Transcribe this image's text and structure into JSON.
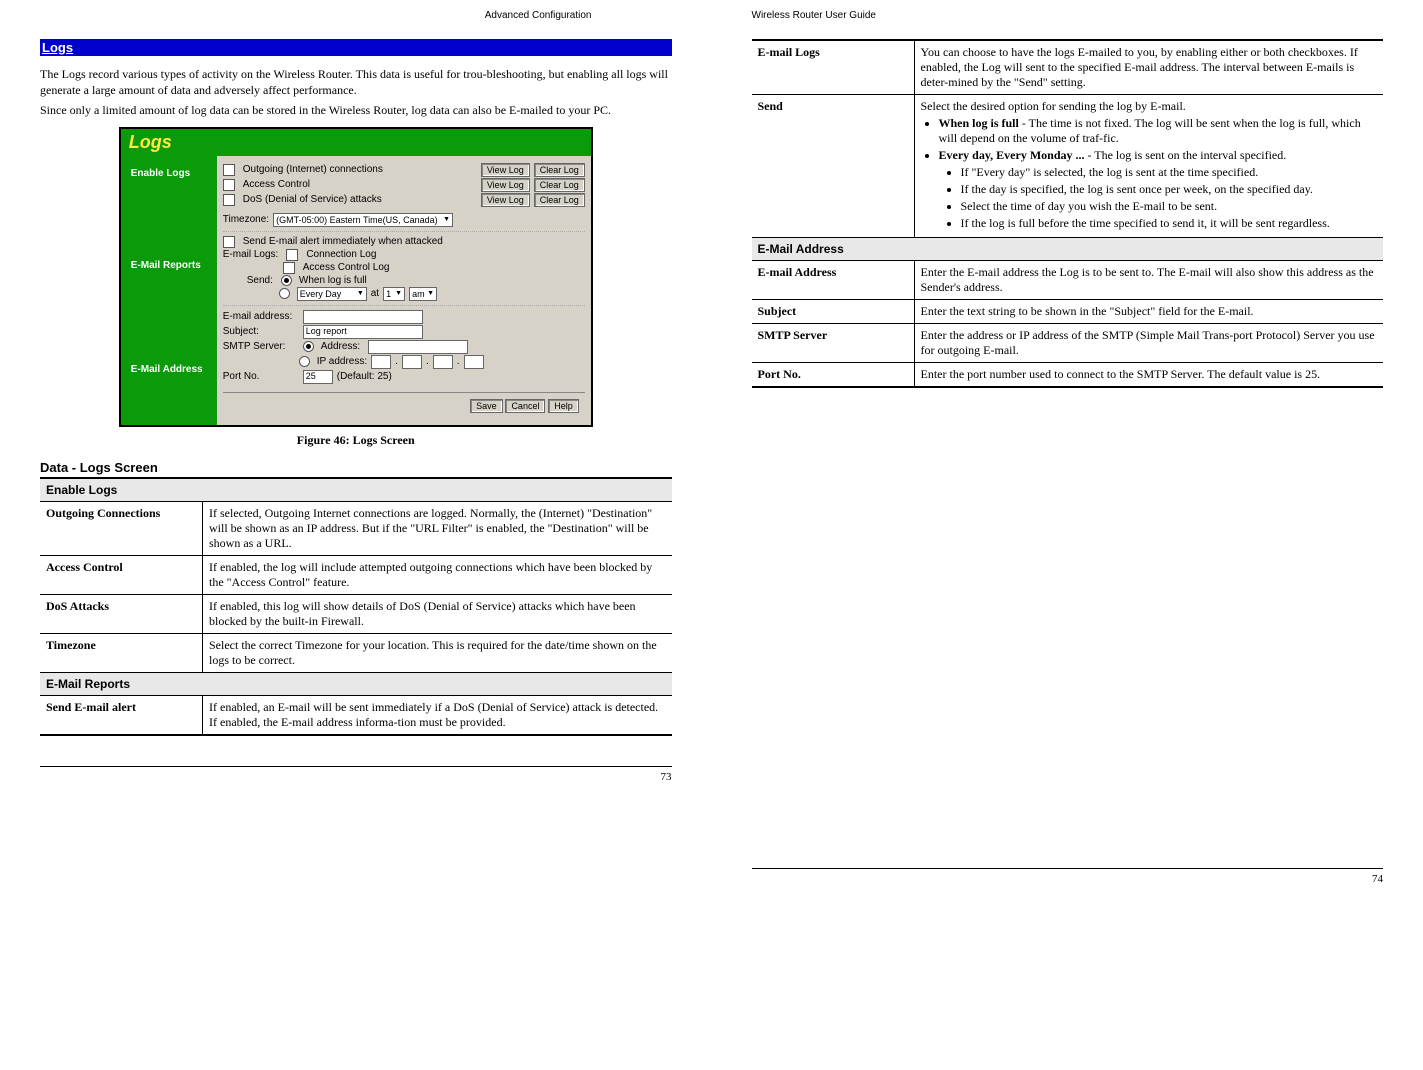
{
  "leftHeader": "Advanced Configuration",
  "rightHeader": "Wireless Router User Guide",
  "leftPageNum": "73",
  "rightPageNum": "74",
  "logs": {
    "bar": "Logs",
    "intro1": "The Logs record various types of activity on the Wireless Router. This data is useful for trou-bleshooting, but enabling all logs will generate a large amount of data and adversely affect performance.",
    "intro2": "Since only a limited amount of log data can be stored in the Wireless Router, log data can also be E-mailed to your PC.",
    "figCaption": "Figure 46: Logs Screen",
    "dataHeader": "Data - Logs Screen",
    "window": {
      "title": "Logs",
      "tab1": "Enable Logs",
      "tab2": "E-Mail Reports",
      "tab3": "E-Mail Address",
      "cb1": "Outgoing (Internet) connections",
      "cb2": "Access Control",
      "cb3": "DoS (Denial of Service) attacks",
      "viewLog": "View Log",
      "clearLog": "Clear Log",
      "tzLabel": "Timezone:",
      "tzValue": "(GMT-05:00) Eastern Time(US, Canada)",
      "alertCb": "Send E-mail alert immediately when attacked",
      "emailLogsLbl": "E-mail Logs:",
      "connLog": "Connection Log",
      "accLog": "Access Control Log",
      "sendLbl": "Send:",
      "sendOpt1": "When log is full",
      "sendOpt2": "Every Day",
      "atLbl": "at",
      "hourVal": "1",
      "ampmVal": "am",
      "emailAddrLbl": "E-mail address:",
      "subjectLbl": "Subject:",
      "subjectVal": "Log report",
      "smtpLbl": "SMTP Server:",
      "smtpAddr": "Address:",
      "smtpIp": "IP address:",
      "portLbl": "Port No.",
      "portVal": "25",
      "portDefault": "(Default: 25)",
      "save": "Save",
      "cancel": "Cancel",
      "help": "Help"
    },
    "tableLeft": {
      "sec1": "Enable Logs",
      "r1k": "Outgoing Connections",
      "r1v": "If selected, Outgoing Internet connections are logged. Normally, the (Internet) \"Destination\" will be shown as an IP address. But if the \"URL Filter\" is enabled, the \"Destination\" will be shown as a URL.",
      "r2k": "Access Control",
      "r2v": "If enabled, the log will include attempted outgoing connections which have been blocked by the \"Access Control\" feature.",
      "r3k": "DoS Attacks",
      "r3v": "If enabled, this log will show details of DoS (Denial of Service) attacks which have been blocked by the built-in Firewall.",
      "r4k": "Timezone",
      "r4v": "Select the correct Timezone for your location. This is required for the date/time shown on the logs to be correct.",
      "sec2": "E-Mail Reports",
      "r5k": "Send E-mail alert",
      "r5v": "If enabled, an E-mail will be sent immediately if a DoS (Denial of Service) attack is detected. If enabled, the E-mail address informa-tion must be provided."
    },
    "tableRight": {
      "r1k": "E-mail Logs",
      "r1v": "You can choose to have the logs E-mailed to you, by enabling either or both checkboxes. If enabled, the Log will sent to the specified E-mail address. The interval between E-mails is deter-mined by the \"Send\" setting.",
      "r2k": "Send",
      "r2v_intro": "Select the desired option for sending the log by E-mail.",
      "r2_b1_strong": "When log is full",
      "r2_b1_rest": " - The time is not fixed. The log will be sent when the log is full, which will depend on the volume of traf-fic.",
      "r2_b2_strong": "Every day, Every Monday ...",
      "r2_b2_rest": "  - The log is sent on the interval specified.",
      "r2_s1": "If \"Every day\" is selected, the log is sent at the time specified.",
      "r2_s2": "If the day is specified, the log is sent once per week, on the specified day.",
      "r2_s3": "Select the time of day you wish the E-mail to be sent.",
      "r2_s4": "If the log is full before the time specified to send it, it will be sent regardless.",
      "sec3": "E-Mail Address",
      "r3k": "E-mail Address",
      "r3v": "Enter the E-mail address the Log is to be sent to. The E-mail will also show this address as the Sender's address.",
      "r4k": "Subject",
      "r4v": "Enter the text string to be shown in the \"Subject\" field for the E-mail.",
      "r5k": "SMTP Server",
      "r5v": "Enter the address or IP address of the SMTP (Simple Mail Trans-port Protocol) Server you use for outgoing E-mail.",
      "r6k": "Port No.",
      "r6v": "Enter the port number used to connect to the SMTP Server. The default value is 25."
    }
  }
}
